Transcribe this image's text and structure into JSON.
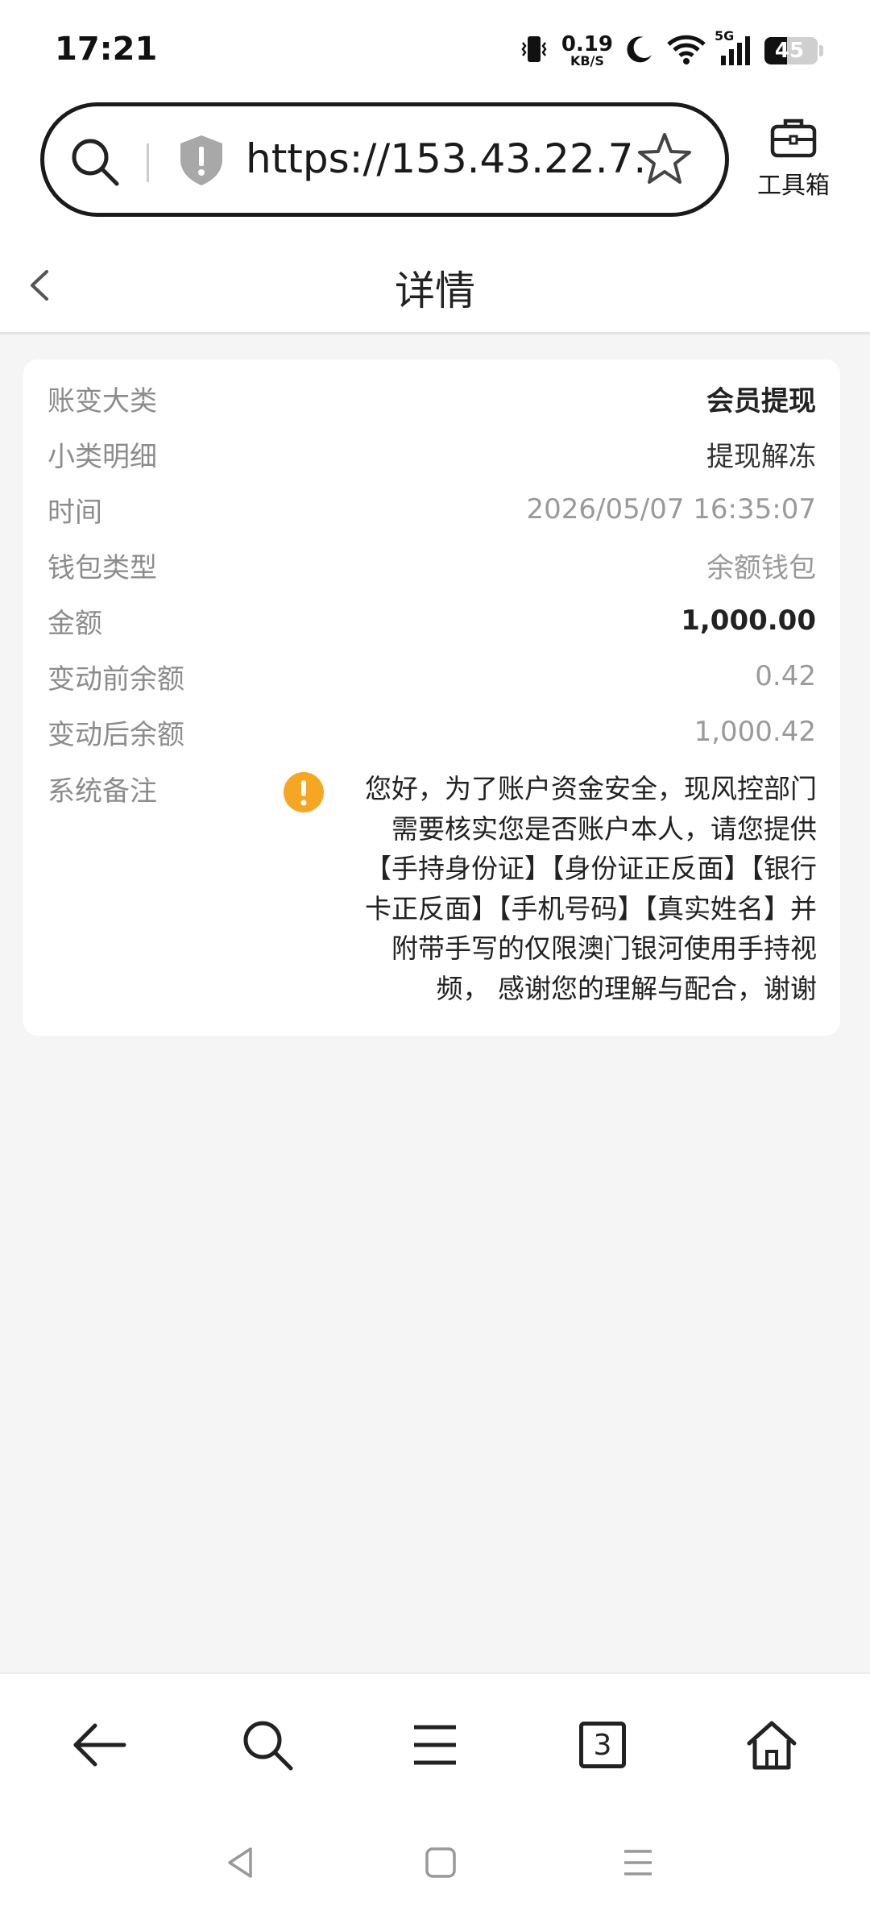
{
  "status_bar": {
    "time": "17:21",
    "net_speed_value": "0.19",
    "net_speed_unit": "KB/S",
    "network_label": "5G",
    "battery": "45"
  },
  "browser": {
    "url": "https://153.43.22.7...",
    "toolbox_label": "工具箱"
  },
  "header": {
    "title": "详情"
  },
  "details": {
    "rows": [
      {
        "label": "账变大类",
        "value": "会员提现"
      },
      {
        "label": "小类明细",
        "value": "提现解冻"
      },
      {
        "label": "时间",
        "value": "2026/05/07 16:35:07"
      },
      {
        "label": "钱包类型",
        "value": "余额钱包"
      },
      {
        "label": "金额",
        "value": "1,000.00"
      },
      {
        "label": "变动前余额",
        "value": "0.42"
      },
      {
        "label": "变动后余额",
        "value": "1,000.42"
      }
    ],
    "remark_label": "系统备注",
    "remark_text": "您好，为了账户资金安全，现风控部门需要核实您是否账户本人，请您提供【手持身份证】【身份证正反面】【银行卡正反面】【手机号码】【真实姓名】并附带手写的仅限澳门银河使用手持视频， 感谢您的理解与配合，谢谢"
  },
  "bottom_nav": {
    "tab_count": "3"
  },
  "colors": {
    "warning": "#f5a623",
    "muted_text": "#9a9a9a",
    "label_text": "#8c8c8c"
  },
  "icons": [
    "search-icon",
    "shield-icon",
    "star-icon",
    "toolbox-icon",
    "back-icon",
    "warning-icon",
    "home-icon",
    "menu-icon"
  ]
}
